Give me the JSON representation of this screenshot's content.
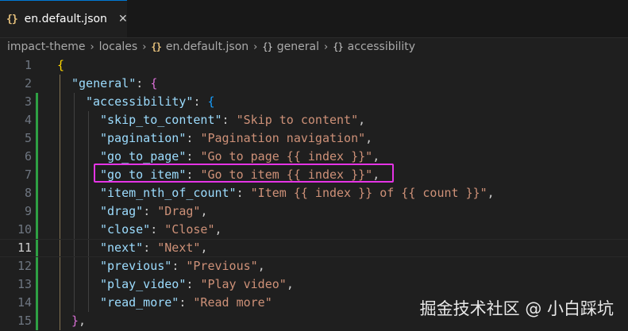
{
  "tab": {
    "icon": "{}",
    "label": "en.default.json",
    "close": "✕"
  },
  "breadcrumb": {
    "items": [
      "impact-theme",
      "locales",
      "en.default.json",
      "general",
      "accessibility"
    ],
    "json_icon": "{}",
    "object_icon": "{}"
  },
  "editor": {
    "active_line": "11",
    "line_numbers": [
      "1",
      "2",
      "3",
      "4",
      "5",
      "6",
      "7",
      "8",
      "9",
      "10",
      "11",
      "12",
      "13",
      "14",
      "15"
    ],
    "lines": [
      {
        "t1": "{"
      },
      {
        "k": "\"general\"",
        "p": ": ",
        "b": "{"
      },
      {
        "k": "\"accessibility\"",
        "p": ": ",
        "b": "{"
      },
      {
        "k": "\"skip_to_content\"",
        "p": ": ",
        "s": "\"Skip to content\"",
        "e": ","
      },
      {
        "k": "\"pagination\"",
        "p": ": ",
        "s": "\"Pagination navigation\"",
        "e": ","
      },
      {
        "k": "\"go_to_page\"",
        "p": ": ",
        "s": "\"Go to page {{ index }}\"",
        "e": ","
      },
      {
        "k": "\"go_to_item\"",
        "p": ": ",
        "s": "\"Go to item {{ index }}\"",
        "e": ","
      },
      {
        "k": "\"item_nth_of_count\"",
        "p": ": ",
        "s": "\"Item {{ index }} of {{ count }}\"",
        "e": ","
      },
      {
        "k": "\"drag\"",
        "p": ": ",
        "s": "\"Drag\"",
        "e": ","
      },
      {
        "k": "\"close\"",
        "p": ": ",
        "s": "\"Close\"",
        "e": ","
      },
      {
        "k": "\"next\"",
        "p": ": ",
        "s": "\"Next\"",
        "e": ","
      },
      {
        "k": "\"previous\"",
        "p": ": ",
        "s": "\"Previous\"",
        "e": ","
      },
      {
        "k": "\"play_video\"",
        "p": ": ",
        "s": "\"Play video\"",
        "e": ","
      },
      {
        "k": "\"read_more\"",
        "p": ": ",
        "s": "\"Read more\""
      },
      {
        "b": "}",
        "e": ","
      }
    ]
  },
  "watermark": "掘金技术社区 @ 小白踩坑",
  "colors": {
    "key": "#9cdcfe",
    "string": "#ce9178",
    "bracket_level1": "#ffd700",
    "bracket_level2": "#da70d6",
    "bracket_level3": "#179fff",
    "highlight_box": "#e534e5",
    "modified_gutter": "#2ea043"
  }
}
